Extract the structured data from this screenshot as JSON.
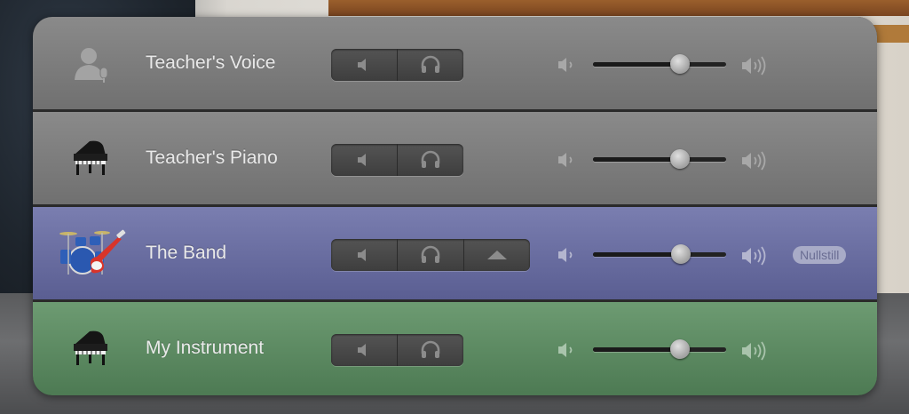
{
  "tracks": [
    {
      "name": "Teacher's Voice",
      "icon": "microphone-person-icon",
      "color": "#7c7c7c",
      "buttons": [
        "mute-icon",
        "headphones-icon"
      ],
      "volume": 0.65
    },
    {
      "name": "Teacher's Piano",
      "icon": "grand-piano-icon",
      "color": "#7c7c7c",
      "buttons": [
        "mute-icon",
        "headphones-icon"
      ],
      "volume": 0.65
    },
    {
      "name": "The Band",
      "icon": "drum-kit-guitar-icon",
      "color": "#6a6ea1",
      "buttons": [
        "mute-icon",
        "headphones-icon",
        "expand-up-icon"
      ],
      "volume": 0.66,
      "reset_label": "Nullstill"
    },
    {
      "name": "My Instrument",
      "icon": "grand-piano-icon",
      "color": "#5d8b63",
      "buttons": [
        "mute-icon",
        "headphones-icon"
      ],
      "volume": 0.65
    }
  ]
}
